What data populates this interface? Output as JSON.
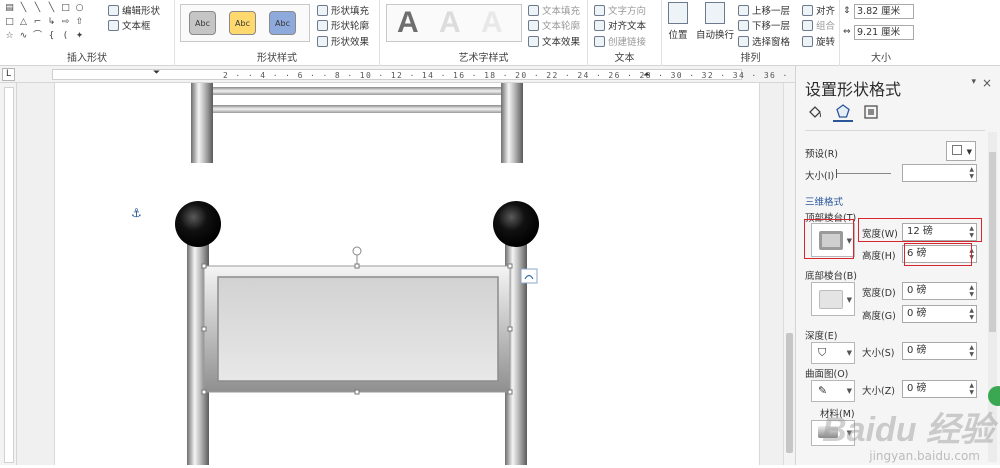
{
  "ribbon": {
    "groups": {
      "insert_shapes": "插入形状",
      "shape_styles": "形状样式",
      "wordart_styles": "艺术字样式",
      "text": "文本",
      "arrange": "排列",
      "size": "大小"
    },
    "insert_shapes": {
      "edit_shape": "编辑形状",
      "text_box": "文本框"
    },
    "shape_styles": {
      "swatches": [
        "Abc",
        "Abc",
        "Abc"
      ],
      "fill": "形状填充",
      "outline": "形状轮廓",
      "effects": "形状效果"
    },
    "wordart": {
      "letters": [
        "A",
        "A",
        "A"
      ],
      "text_fill": "文本填充",
      "text_outline": "文本轮廓",
      "text_effects": "文本效果"
    },
    "text": {
      "direction": "文字方向",
      "align": "对齐文本",
      "create_link": "创建链接"
    },
    "arrange": {
      "position": "位置",
      "wrap": "自动换行",
      "bring_forward": "上移一层",
      "send_backward": "下移一层",
      "selection_pane": "选择窗格",
      "align": "对齐",
      "group": "组合",
      "rotate": "旋转"
    },
    "size": {
      "height": "3.82 厘米",
      "width": "9.21 厘米"
    }
  },
  "ruler": {
    "corner": "L",
    "scale": "2 · · 4 · · 6 · · 8 · 10 · 12 · 14 · 16 · 18 · 20 · 22 · 24 · 26 · 28 · 30 · 32 · 34 · 36 · 38 · 40 · 42"
  },
  "panel": {
    "title": "设置形状格式",
    "close": "×",
    "dropdown": "▾",
    "preset_label": "预设(R)",
    "size_label": "大小(I)",
    "section_3d": "三维格式",
    "top_bevel_label": "顶部棱台(T)",
    "top_width_label": "宽度(W)",
    "top_width_value": "12 磅",
    "top_height_label": "高度(H)",
    "top_height_value": "6 磅",
    "bottom_bevel_label": "底部棱台(B)",
    "bottom_width_label": "宽度(D)",
    "bottom_width_value": "0 磅",
    "bottom_height_label": "高度(G)",
    "bottom_height_value": "0 磅",
    "depth_label": "深度(E)",
    "depth_size_label": "大小(S)",
    "depth_size_value": "0 磅",
    "contour_label": "曲面图(O)",
    "contour_size_label": "大小(Z)",
    "contour_size_value": "0 磅",
    "material_label": "材料(M)"
  },
  "watermark": {
    "logo": "Baidu 经验",
    "url": "jingyan.baidu.com"
  },
  "colors": {
    "accent": "#2b579a",
    "highlight": "#d7262e",
    "section_blue": "#2b579a"
  }
}
